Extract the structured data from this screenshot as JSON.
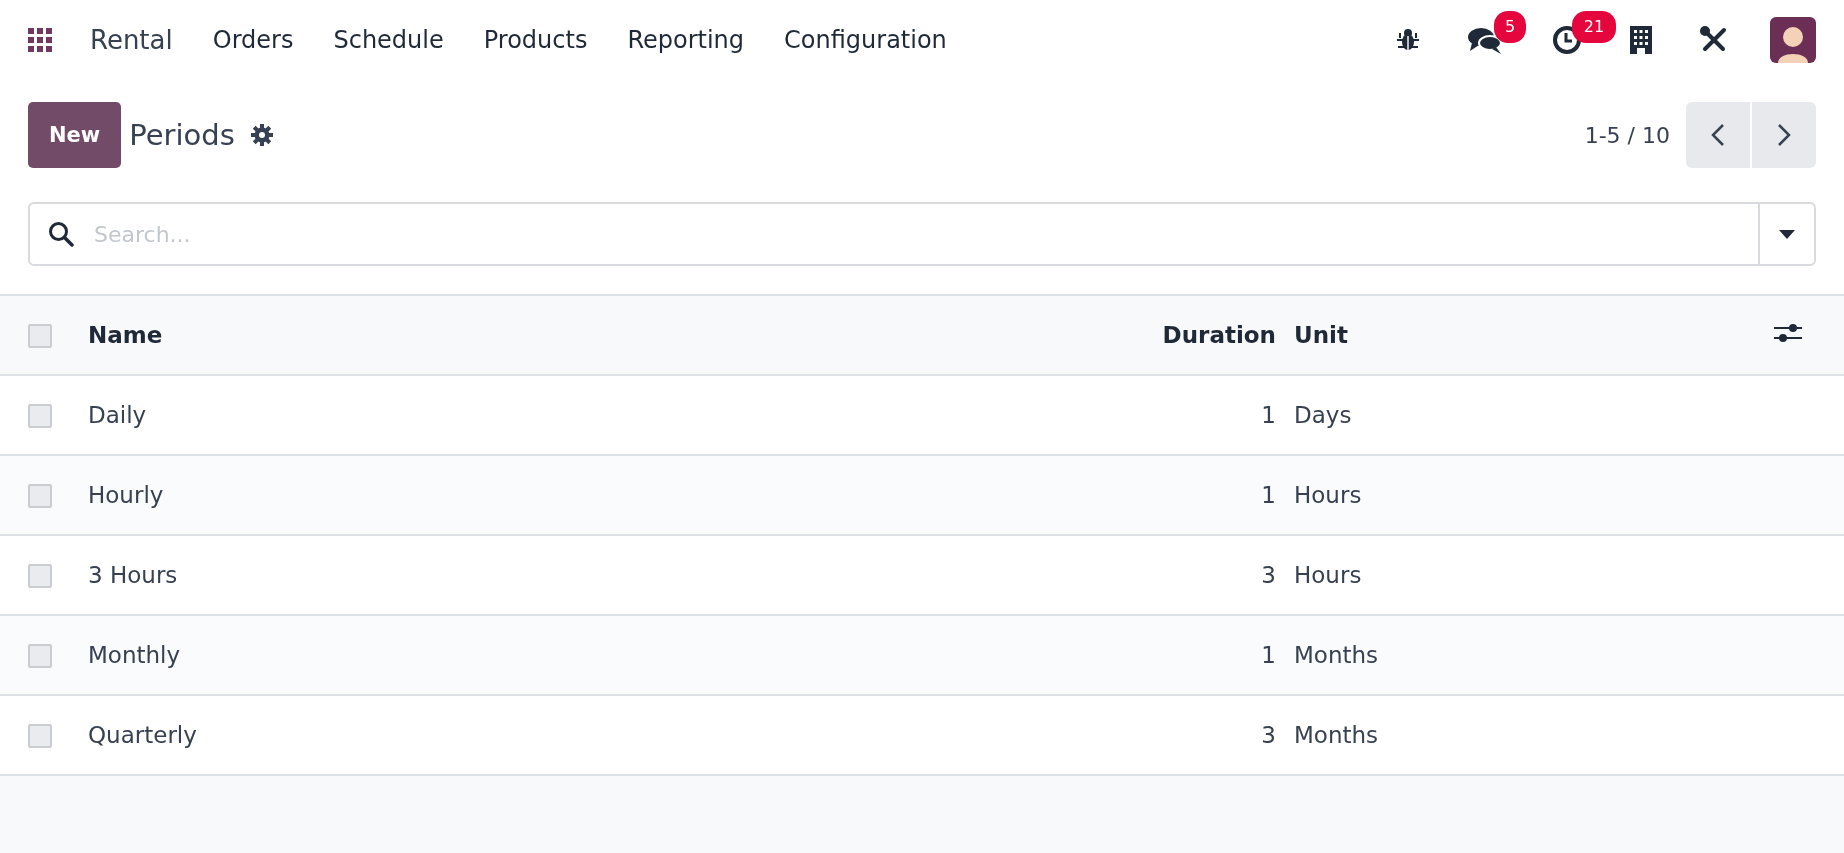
{
  "navbar": {
    "app_name": "Rental",
    "menu": [
      "Orders",
      "Schedule",
      "Products",
      "Reporting",
      "Configuration"
    ],
    "messages_badge": "5",
    "activities_badge": "21"
  },
  "control_panel": {
    "new_button": "New",
    "title": "Periods",
    "pager": "1-5 / 10"
  },
  "search": {
    "placeholder": "Search..."
  },
  "table": {
    "select_all_checked": false,
    "columns": [
      "Name",
      "Duration",
      "Unit"
    ],
    "rows": [
      {
        "name": "Daily",
        "duration": "1",
        "unit": "Days",
        "checked": false
      },
      {
        "name": "Hourly",
        "duration": "1",
        "unit": "Hours",
        "checked": false
      },
      {
        "name": "3 Hours",
        "duration": "3",
        "unit": "Hours",
        "checked": false
      },
      {
        "name": "Monthly",
        "duration": "1",
        "unit": "Months",
        "checked": false
      },
      {
        "name": "Quarterly",
        "duration": "3",
        "unit": "Months",
        "checked": false
      }
    ]
  }
}
